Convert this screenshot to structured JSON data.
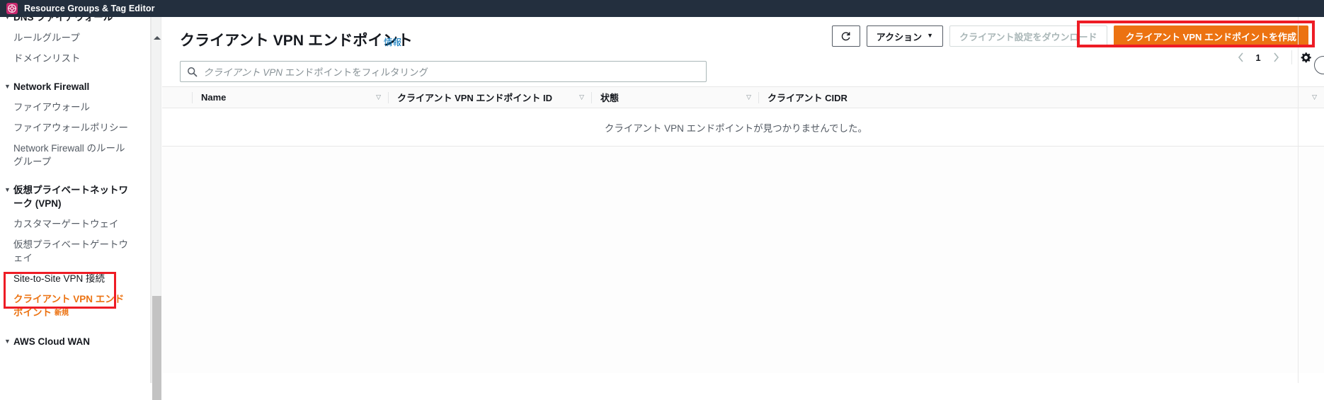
{
  "topbar": {
    "logo_icon": "resource-groups-logo-icon",
    "title": "Resource Groups & Tag Editor"
  },
  "sidebar": {
    "items": [
      {
        "type": "group",
        "label": "DNS ファイアウォール",
        "caret": "▼"
      },
      {
        "type": "item",
        "label": "ルールグループ"
      },
      {
        "type": "item",
        "label": "ドメインリスト"
      },
      {
        "type": "group",
        "label": "Network Firewall",
        "caret": "▼"
      },
      {
        "type": "item",
        "label": "ファイアウォール"
      },
      {
        "type": "item",
        "label": "ファイアウォールポリシー"
      },
      {
        "type": "item",
        "label": "Network Firewall のルールグループ"
      },
      {
        "type": "group",
        "label": "仮想プライベートネットワーク (VPN)",
        "caret": "▼"
      },
      {
        "type": "item",
        "label": "カスタマーゲートウェイ"
      },
      {
        "type": "item",
        "label": "仮想プライベートゲートウェイ"
      },
      {
        "type": "item",
        "label": "Site-to-Site VPN 接続"
      },
      {
        "type": "item-active",
        "label": "クライアント VPN エンドポイント",
        "badge": "新規"
      },
      {
        "type": "group",
        "label": "AWS Cloud WAN",
        "caret": "▼"
      }
    ]
  },
  "header": {
    "title": "クライアント VPN エンドポイント",
    "info_label": "情報",
    "refresh_icon": "refresh-icon",
    "actions_label": "アクション",
    "actions_caret": "▼",
    "download_label": "クライアント設定をダウンロード",
    "create_label": "クライアント VPN エンドポイントを作成"
  },
  "search": {
    "icon": "search-icon",
    "placeholder_italic": "クライアント VPN",
    "placeholder_rest": " エンドポイントをフィルタリング"
  },
  "pagination": {
    "prev_icon": "chevron-left-icon",
    "page": "1",
    "next_icon": "chevron-right-icon",
    "settings_icon": "gear-icon"
  },
  "table": {
    "columns": [
      {
        "label": "Name",
        "sort_icon": "▽"
      },
      {
        "label": "クライアント VPN エンドポイント ID",
        "sort_icon": "▽"
      },
      {
        "label": "状態",
        "sort_icon": "▽"
      },
      {
        "label": "クライアント CIDR",
        "sort_icon": "▽"
      }
    ],
    "empty_message": "クライアント VPN エンドポイントが見つかりませんでした。",
    "rows": []
  },
  "annotations": {
    "sidebar_highlight": "クライアント VPN エンドポイント",
    "create_button_highlight": "クライアント VPN エンドポイントを作成",
    "color": "#ee1c25"
  },
  "colors": {
    "topbar_bg": "#232f3e",
    "accent_orange": "#ec7211",
    "link_blue": "#0073bb",
    "annotation_red": "#ee1c25"
  }
}
